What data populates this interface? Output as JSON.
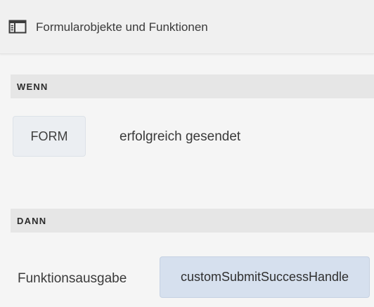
{
  "header": {
    "icon": "panel-layout-icon",
    "title": "Formularobjekte und Funktionen"
  },
  "when_section": {
    "label": "WENN",
    "object_chip": "FORM",
    "condition_text": "erfolgreich gesendet"
  },
  "then_section": {
    "label": "DANN",
    "action_label": "Funktionsausgabe",
    "function_chip": "customSubmitSuccessHandle"
  },
  "colors": {
    "background": "#f5f5f5",
    "section_bar": "#e6e6e6",
    "object_chip_bg": "#ebeef2",
    "function_chip_bg": "#d6e0ee"
  }
}
